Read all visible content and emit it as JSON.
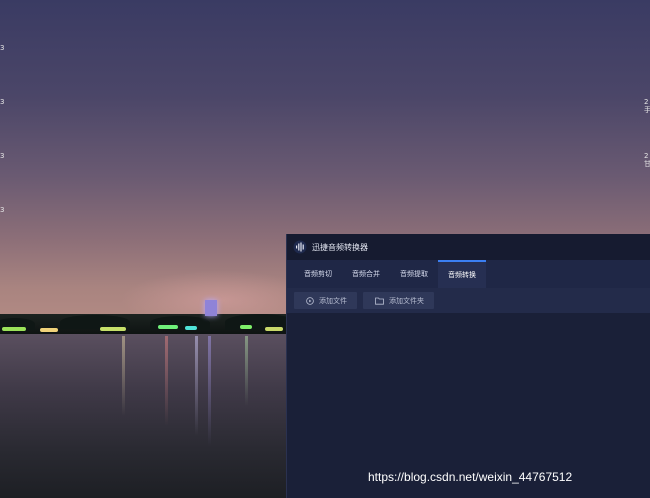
{
  "desktop": {
    "edge_labels_left": [
      "3",
      "3",
      "3",
      "3"
    ],
    "edge_labels_right": [
      "2",
      "手",
      "2",
      "甘"
    ]
  },
  "app": {
    "title": "迅捷音频转换器",
    "tabs": [
      {
        "label": "音频剪切",
        "active": false
      },
      {
        "label": "音频合并",
        "active": false
      },
      {
        "label": "音频提取",
        "active": false
      },
      {
        "label": "音频转换",
        "active": true
      }
    ],
    "toolbar": {
      "add_file_label": "添加文件",
      "add_folder_label": "添加文件夹"
    },
    "colors": {
      "accent": "#3b7ff2",
      "window_bg": "#1a2038",
      "tabbar_bg": "#1f2746"
    },
    "icons": {
      "logo": "audio-wave-icon",
      "add_file": "add-circle-icon",
      "add_folder": "folder-icon"
    }
  },
  "watermark": {
    "text": "https://blog.csdn.net/weixin_44767512"
  }
}
